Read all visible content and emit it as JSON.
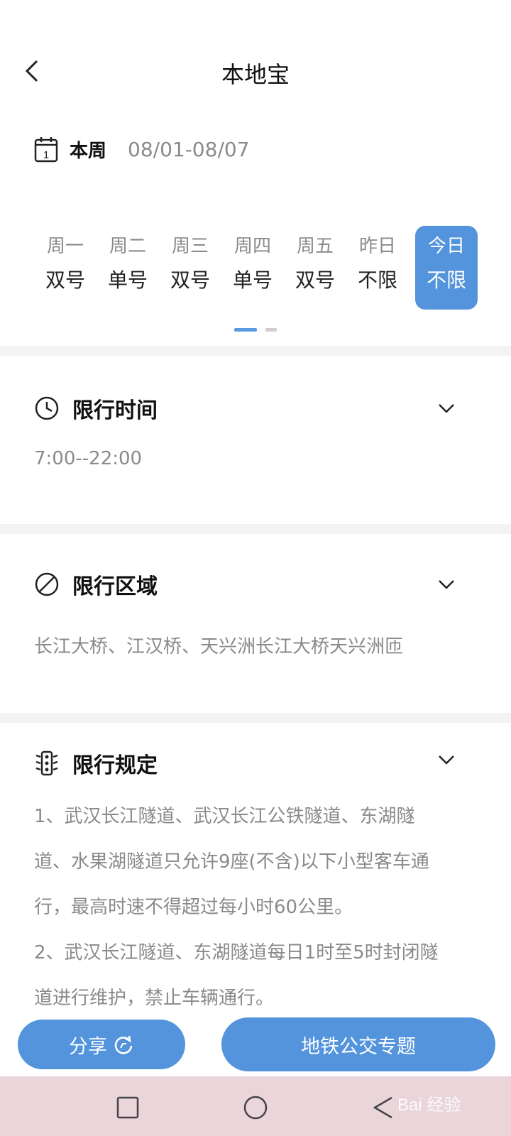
{
  "header": {
    "title": "本地宝",
    "back_icon": "chevron-left-icon"
  },
  "week": {
    "icon": "calendar-icon",
    "calendar_day": "1",
    "label": "本周",
    "range": "08/01-08/07"
  },
  "days": [
    {
      "name": "周一",
      "value": "双号",
      "active": false
    },
    {
      "name": "周二",
      "value": "单号",
      "active": false
    },
    {
      "name": "周三",
      "value": "双号",
      "active": false
    },
    {
      "name": "周四",
      "value": "单号",
      "active": false
    },
    {
      "name": "周五",
      "value": "双号",
      "active": false
    },
    {
      "name": "昨日",
      "value": "不限",
      "active": false
    },
    {
      "name": "今日",
      "value": "不限",
      "active": true
    }
  ],
  "pager": {
    "current_page": 1,
    "total_pages": 2
  },
  "sections": {
    "time": {
      "icon": "clock-icon",
      "title": "限行时间",
      "text": "7:00--22:00"
    },
    "area": {
      "icon": "no-entry-icon",
      "title": "限行区域",
      "text": "长江大桥、江汉桥、天兴洲长江大桥天兴洲匝"
    },
    "rules": {
      "icon": "traffic-light-icon",
      "title": "限行规定",
      "lines": [
        "1、武汉长江隧道、武汉长江公铁隧道、东湖隧",
        "道、水果湖隧道只允许9座(不含)以下小型客车通",
        "行，最高时速不得超过每小时60公里。",
        "2、武汉长江隧道、东湖隧道每日1时至5时封闭隧",
        "道进行维护，禁止车辆通行。"
      ]
    }
  },
  "buttons": {
    "share": "分享",
    "metro": "地铁公交专题"
  },
  "watermark": "Bai 经验",
  "colors": {
    "accent": "#5494dc",
    "navbar": "#e9d5da",
    "muted_text": "#8a8a8a"
  }
}
